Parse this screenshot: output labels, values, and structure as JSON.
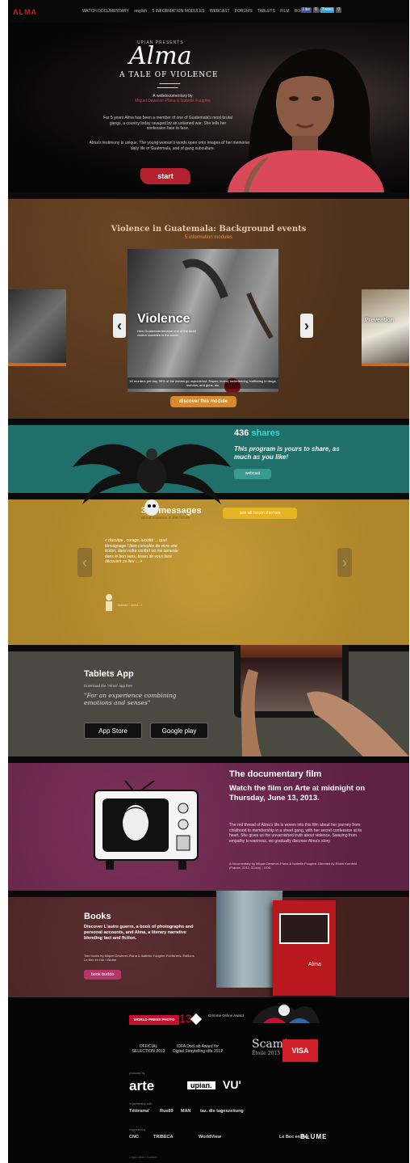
{
  "topbar": {
    "logo": "ALMA",
    "nav": [
      "WATCH DOCUMENTARY",
      "english",
      "5 INFORMATION MODULES",
      "WEBCAST",
      "FORUMS",
      "TABLETS",
      "FILM",
      "BOOKS",
      "ABOUT US"
    ],
    "social": [
      "Like",
      "0",
      "Tweet",
      "0"
    ]
  },
  "hero": {
    "presents": "UPIAN PRESENTS",
    "title": "Alma",
    "subtitle": "A TALE OF VIOLENCE",
    "doc_line": "A webdocumentary by",
    "doc_authors": "Miquel Dewever-Plana & Isabelle Fougère",
    "text1": "For 5 years Alma has been a member of one of Guatemala's most brutal gangs, a country today ravaged by an untamed war. She tells her confession face to face.",
    "text2": "Alma's testimony is unique. The young woman's words open onto images of her memories, of daily life in Guatemala, and of gang subculture.",
    "start": "start"
  },
  "violence": {
    "heading": "Violence in Guatemala: Background events",
    "subheading": "5 information modules",
    "slide_title": "Violence",
    "slide_sub": "How Guatemala became one of the most violent countries in the world.",
    "caption": "16 murders per day, 98% of the crimes go unpunished. Rapes, incest, racketeering, trafficking in drugs, humans, and guns, etc.",
    "right_slide": "Prevention",
    "prev": "‹",
    "next": "›",
    "discover": "discover this module"
  },
  "shares": {
    "count": "436",
    "word": "shares",
    "message": "This program is yours to share, as much as you like!",
    "button": "webcast"
  },
  "messages": {
    "count": "319 messages",
    "sub": "about violence in the forum",
    "forum_button": "see all forum themes",
    "quote": "« disculpe , corage, lucidité ... quel témoignage ! bien consolée de vivre une fiction, dans notre confort où me lamente dans le bon sens, bravo de vous faire découvrir ce lieu ... »",
    "author": "Natalie - 40/11 -7",
    "prev": "‹",
    "next": "›"
  },
  "tablets": {
    "heading": "Tablets App",
    "download": "Download the \"Alma\" app free",
    "quote": "\"For an experience combining emotions and senses\"",
    "appstore": "App Store",
    "googleplay": "Google play"
  },
  "documentary": {
    "heading": "The documentary film",
    "subheading": "Watch the film on Arte at midnight on Thursday, June 13, 2013.",
    "body": "The red thread of Alma's life is woven into this film about her journey from childhood to membership in a street gang, with her secret confession at its heart. She gives us the unvarnished truth about violence. Swaying from empathy to wariness, we gradually discover Alma's story.",
    "credits": "A documentary by Miquel Dewever-Plana & Isabelle Fougère. Directed by Robin Kornfeld (France, 2012, 52min) - VOD"
  },
  "books": {
    "heading": "Books",
    "desc": "Discover L'autre guerre, a book of photographs and personal accounts, and Alma, a literary narrative blending fact and fiction.",
    "desc2": "Two books by Miquel Dewever-Plana & Isabelle Fougère Publishers: Éditions Le Bec en l'Air / Blume",
    "button": "book buddo",
    "book_title": "Alma"
  },
  "footer": {
    "wpp": "WORLD PRESS PHOTO",
    "wpp_year": "13",
    "grimme": "Grimme Online Award",
    "award1": "OFFICIAL SELECTION 2013",
    "award2": "IDFA DocLab Award for Digital Storytelling idfa 2012",
    "scam": "Scam*",
    "scam_sub": "Étoile 2013",
    "visa": "VISA",
    "produced_by": "produced by",
    "arte": "arte",
    "upian": "upian.",
    "vu": "VU'",
    "partners_label": "in partnership with",
    "partners": [
      "Télérama'",
      "Rue89",
      "MAN",
      "taz. die tageszeitung"
    ],
    "support_label": "supported by",
    "supporters": [
      "CNC",
      "TRIBECA",
      "WorldView",
      "",
      "Le Bec en l'air"
    ],
    "blume": "BLUME",
    "legal": "Legal notice / Contact"
  }
}
